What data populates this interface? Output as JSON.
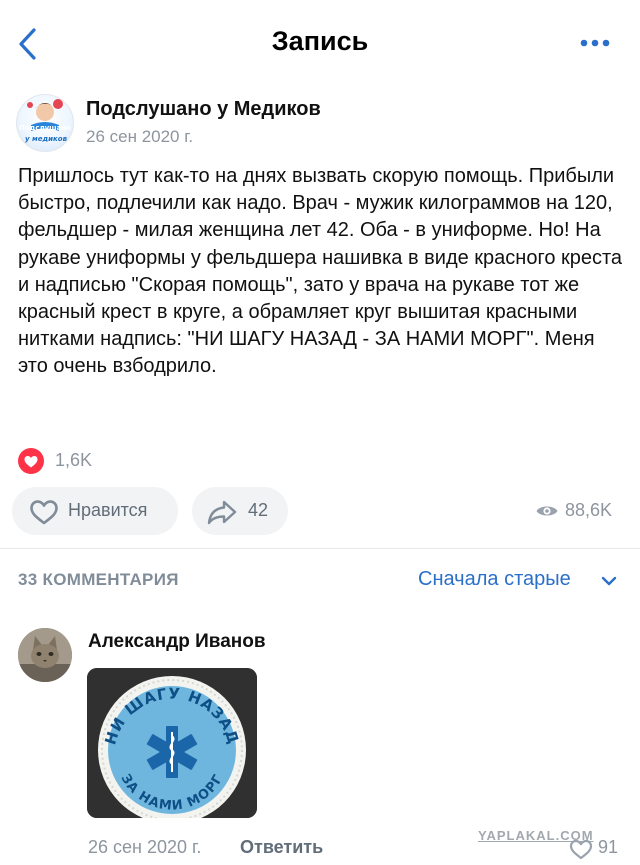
{
  "header": {
    "title": "Запись",
    "back_icon": "chevron-left-icon",
    "more_icon": "more-dots-icon",
    "accent": "#2a6fc9"
  },
  "post": {
    "group_name": "Подслушано у Медиков",
    "group_avatar_text": [
      "Подслушано",
      "у медиков"
    ],
    "date": "26 сен 2020 г.",
    "text": "Пришлось тут как-то на днях вызвать скорую помощь. Прибыли быстро, подлечили как надо. Врач - мужик килограммов на 120, фельдшер - милая женщина лет 42. Оба - в униформе. Но! На рукаве униформы у фельдшера нашивка в виде красного креста и надписью \"Скорая помощь\", зато у врача на рукаве тот же красный крест в круге, а обрамляет круг вышитая красными нитками надпись: \"НИ ШАГУ НАЗАД - ЗА НАМИ МОРГ\". Меня это очень взбодрило.",
    "reactions": {
      "icon": "heart-icon",
      "count": "1,6K",
      "color": "#ff3347"
    },
    "actions": {
      "like_label": "Нравится",
      "share_count": "42",
      "views_count": "88,6K"
    }
  },
  "comments": {
    "count_label": "33 КОММЕНТАРИЯ",
    "sort_label": "Сначала старые",
    "items": [
      {
        "author": "Александр Иванов",
        "image_text_top": "НИ ШАГУ НАЗАД",
        "image_text_bottom": "ЗА НАМИ МОРГ",
        "date": "26 сен 2020 г.",
        "reply_label": "Ответить",
        "likes": "91"
      }
    ]
  },
  "watermark": "YAPLAKAL.COM"
}
